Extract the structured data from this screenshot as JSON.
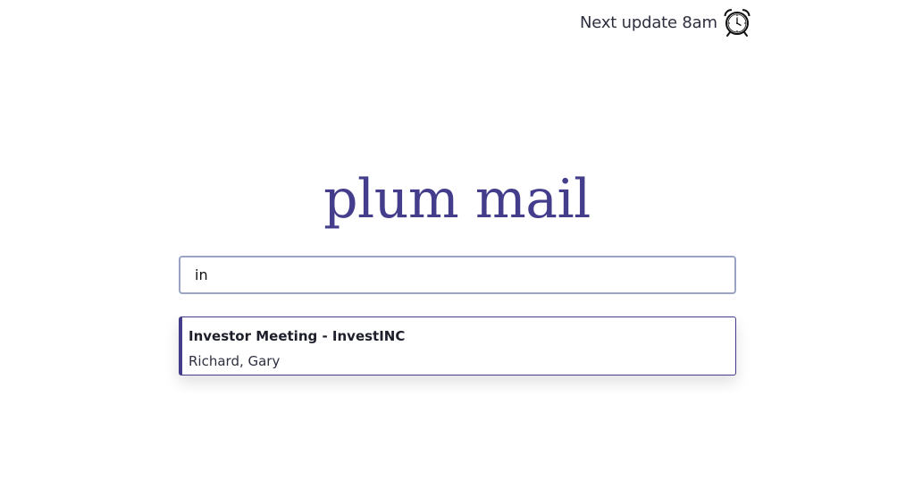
{
  "header": {
    "status_text": "Next update 8am",
    "status_icon": "alarm-clock-icon"
  },
  "logo": {
    "text": "plum mail",
    "color": "#433d8b"
  },
  "search": {
    "value": "in",
    "placeholder": ""
  },
  "results": [
    {
      "title": "Investor Meeting - InvestINC",
      "participants": "Richard, Gary"
    }
  ],
  "colors": {
    "accent": "#433d8b",
    "input_border": "#9aa3c3"
  }
}
